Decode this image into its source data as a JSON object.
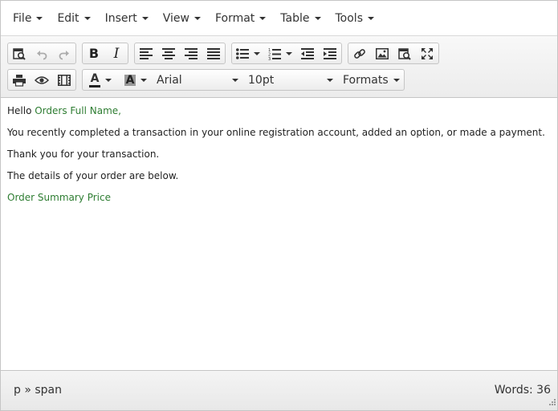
{
  "menubar": {
    "items": [
      {
        "label": "File"
      },
      {
        "label": "Edit"
      },
      {
        "label": "Insert"
      },
      {
        "label": "View"
      },
      {
        "label": "Format"
      },
      {
        "label": "Table"
      },
      {
        "label": "Tools"
      }
    ]
  },
  "toolbar": {
    "font_family": "Arial",
    "font_size": "10pt",
    "formats_label": "Formats",
    "text_color": "#222222",
    "highlight_color": "#999999",
    "icons": {
      "find": "find-replace-icon",
      "undo": "undo-icon",
      "redo": "redo-icon",
      "bold": "bold-icon",
      "italic": "italic-icon",
      "align_left": "align-left-icon",
      "align_center": "align-center-icon",
      "align_right": "align-right-icon",
      "justify": "justify-icon",
      "bullet_list": "bullet-list-icon",
      "numbered_list": "numbered-list-icon",
      "outdent": "outdent-icon",
      "indent": "indent-icon",
      "link": "link-icon",
      "image": "image-icon",
      "preview": "preview-icon",
      "fullscreen": "fullscreen-icon",
      "print": "print-icon",
      "view": "eye-icon",
      "media": "media-icon"
    }
  },
  "content": {
    "greeting": "Hello ",
    "greeting_tag": "Orders Full Name,",
    "line1": "You recently completed a transaction in your online registration account, added an option, or made a payment.",
    "line2": "Thank you for your transaction.",
    "line3": "The details of your order are below.",
    "summary_tag": "Order Summary Price"
  },
  "colors": {
    "tag_green": "#2e7d32"
  },
  "statusbar": {
    "path": "p » span",
    "words": "Words: 36"
  }
}
